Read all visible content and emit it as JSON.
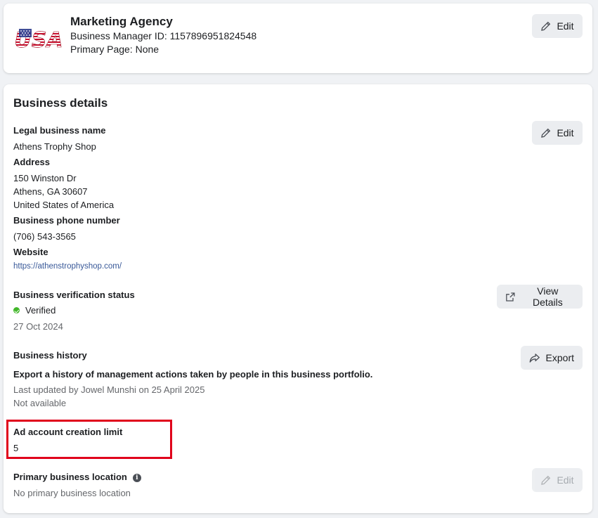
{
  "header": {
    "business_name": "Marketing Agency",
    "manager_id_line": "Business Manager ID: 1157896951824548",
    "primary_page_line": "Primary Page: None",
    "edit_label": "Edit",
    "logo_text": "USA"
  },
  "details": {
    "title": "Business details",
    "edit_label": "Edit",
    "legal_name_label": "Legal business name",
    "legal_name_value": "Athens Trophy Shop",
    "address_label": "Address",
    "address_line1": "150 Winston Dr",
    "address_line2": "Athens, GA 30607",
    "address_line3": "United States of America",
    "phone_label": "Business phone number",
    "phone_value": "(706) 543-3565",
    "website_label": "Website",
    "website_value": "https://athenstrophyshop.com/"
  },
  "verification": {
    "label": "Business verification status",
    "status": "Verified",
    "date": "27 Oct 2024",
    "button_label": "View Details"
  },
  "history": {
    "label": "Business history",
    "description": "Export a history of management actions taken by people in this business portfolio.",
    "last_updated": "Last updated by Jowel Munshi on 25 April 2025",
    "availability": "Not available",
    "button_label": "Export"
  },
  "ad_limit": {
    "label": "Ad account creation limit",
    "value": "5"
  },
  "location": {
    "label": "Primary business location",
    "value": "No primary business location",
    "edit_label": "Edit"
  },
  "colors": {
    "highlight": "#e0001b",
    "verified_green": "#42b72a",
    "link": "#385898"
  },
  "icons": {
    "edit": "pencil-icon",
    "view_details": "external-link-icon",
    "export": "share-arrow-icon",
    "info": "info-icon",
    "verified": "check-circle-icon"
  }
}
